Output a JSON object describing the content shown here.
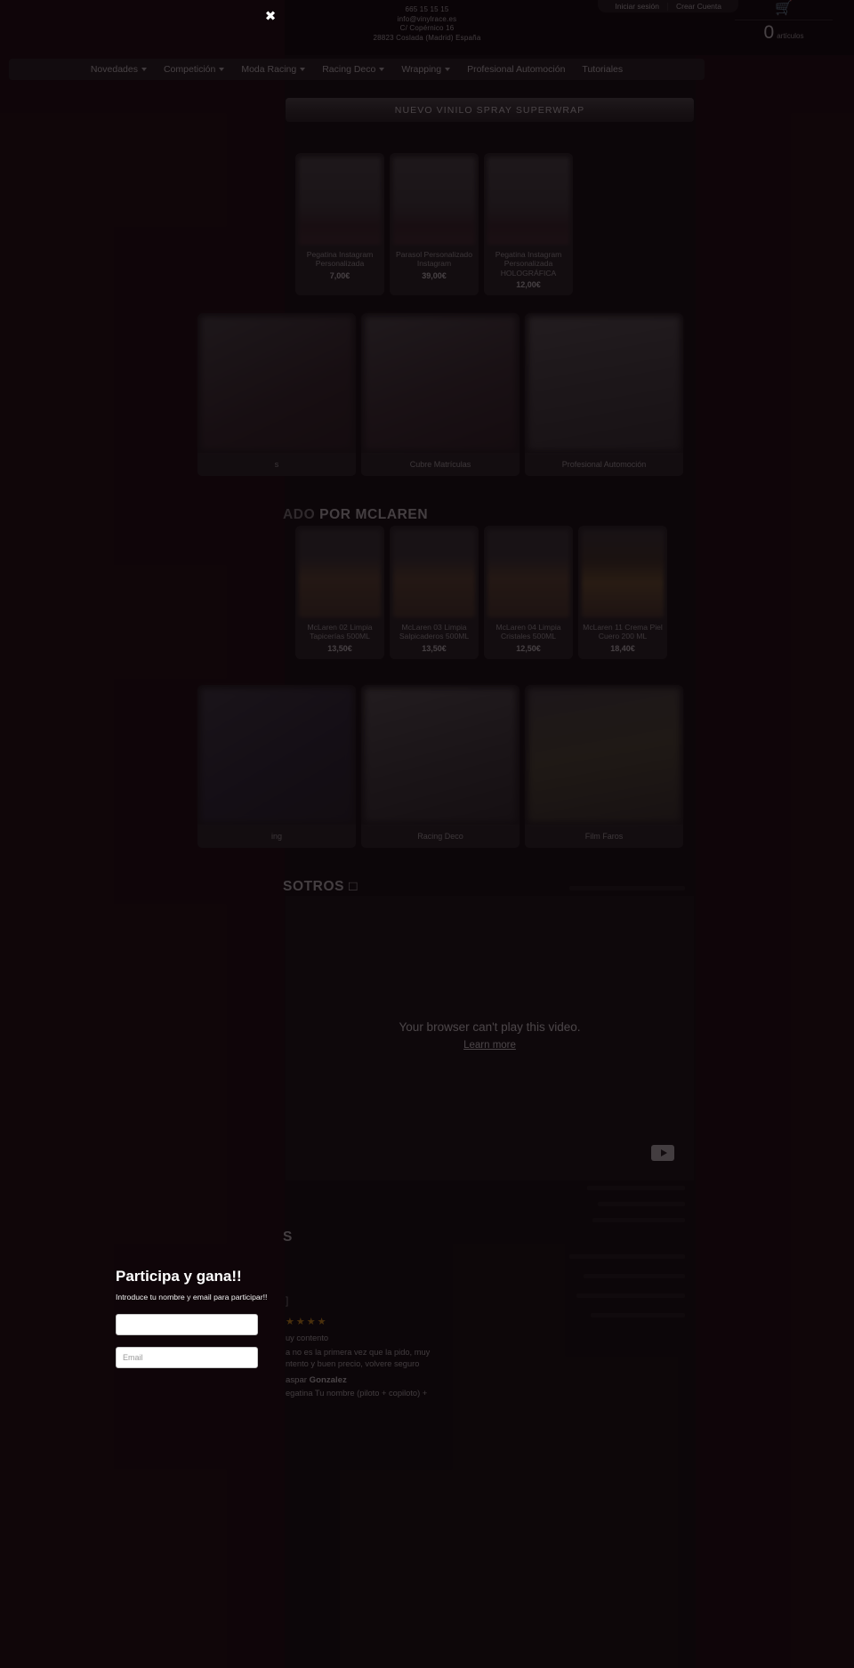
{
  "topbar": {
    "phone": "665 15 15 15",
    "email": "info@vinylrace.es",
    "address1": "C/ Copérnico 16",
    "address2": "28823 Coslada (Madrid) España",
    "login_label": "Iniciar sesión",
    "register_label": "Crear Cuenta",
    "cart_icon": "cart-icon",
    "cart_count": "0",
    "cart_label": "artículos",
    "close_icon": "✖"
  },
  "nav": {
    "items": [
      {
        "label": "Novedades",
        "has_caret": true
      },
      {
        "label": "Competición",
        "has_caret": true
      },
      {
        "label": "Moda Racing",
        "has_caret": true
      },
      {
        "label": "Racing Deco",
        "has_caret": true
      },
      {
        "label": "Wrapping",
        "has_caret": true
      },
      {
        "label": "Profesional Automoción",
        "has_caret": false
      },
      {
        "label": "Tutoriales",
        "has_caret": false
      }
    ]
  },
  "promo": {
    "label": "NUEVO VINILO SPRAY SUPERWRAP"
  },
  "products_row1": [
    {
      "name": "Pegatina Instagram Personalizada",
      "price": "7,00€"
    },
    {
      "name": "Parasol Personalizado Instagram",
      "price": "39,00€"
    },
    {
      "name": "Pegatina Instagram Personalizada HOLOGRÁFICA",
      "price": "12,00€"
    }
  ],
  "categories_row1": [
    {
      "label": "s"
    },
    {
      "label": "Cubre Matrículas"
    },
    {
      "label": "Profesional Automoción"
    }
  ],
  "heading_mclaren": {
    "dim": "ADO",
    "bright": "POR MCLAREN"
  },
  "products_row2": [
    {
      "name": "McLaren 02 Limpia Tapicerías 500ML",
      "price": "13,50€"
    },
    {
      "name": "McLaren 03 Limpia Salpicaderos 500ML",
      "price": "13,50€"
    },
    {
      "name": "McLaren 04 Limpia Cristales 500ML",
      "price": "12,50€"
    },
    {
      "name": "McLaren 11 Crema Piel Cuero 200 ML",
      "price": "18,40€"
    }
  ],
  "categories_row2": [
    {
      "label": "ing"
    },
    {
      "label": "Racing Deco"
    },
    {
      "label": "Film Faros"
    }
  ],
  "heading_about": {
    "dim": "",
    "bright": "SOTROS □"
  },
  "video": {
    "message": "Your browser can't play this video.",
    "learn_more": "Learn more",
    "play_icon": "play-icon"
  },
  "heading_reviews": {
    "dim": "",
    "bright": "S"
  },
  "reviews": {
    "bracket": "]",
    "stars": "★★★★",
    "text_line1": "uy contento",
    "text_line2": "a no es la primera vez que la pido, muy",
    "text_line3": "ntento y buen precio, volvere seguro",
    "text_line4": "egatina Tu nombre (piloto + copiloto) +",
    "author_first": "aspar",
    "author_last": "Gonzalez"
  },
  "popup": {
    "title": "Participa y gana!!",
    "subtitle": "Introduce tu nombre y email para participar!!",
    "name_value": "",
    "name_placeholder": "",
    "email_value": "",
    "email_placeholder": "Email"
  }
}
